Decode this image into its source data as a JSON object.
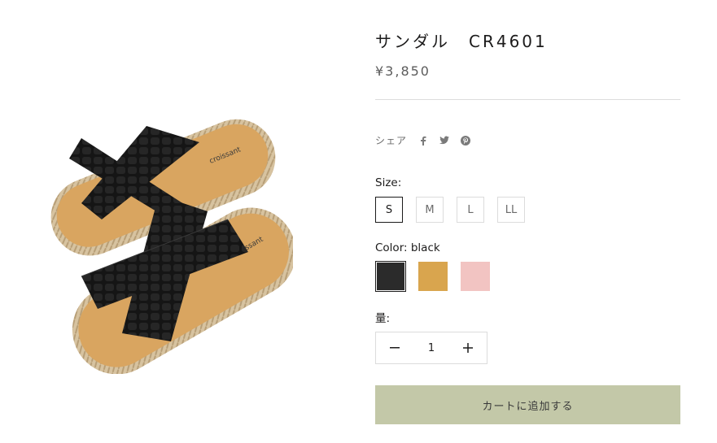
{
  "product": {
    "title": "サンダル　CR4601",
    "price": "¥3,850",
    "image_brand_text": "croissant"
  },
  "share": {
    "label": "シェア",
    "icons": [
      "facebook-icon",
      "twitter-icon",
      "pinterest-icon"
    ]
  },
  "size": {
    "label": "Size:",
    "options": [
      "S",
      "M",
      "L",
      "LL"
    ],
    "selected": "S"
  },
  "color": {
    "label": "Color: black",
    "selected": "black",
    "swatches": [
      "#2b2b2b",
      "#d9a54e",
      "#f2c4c2"
    ]
  },
  "quantity": {
    "label": "量:",
    "value": "1"
  },
  "cart": {
    "label": "カートに追加する",
    "bg_color": "#c3c8a8"
  }
}
